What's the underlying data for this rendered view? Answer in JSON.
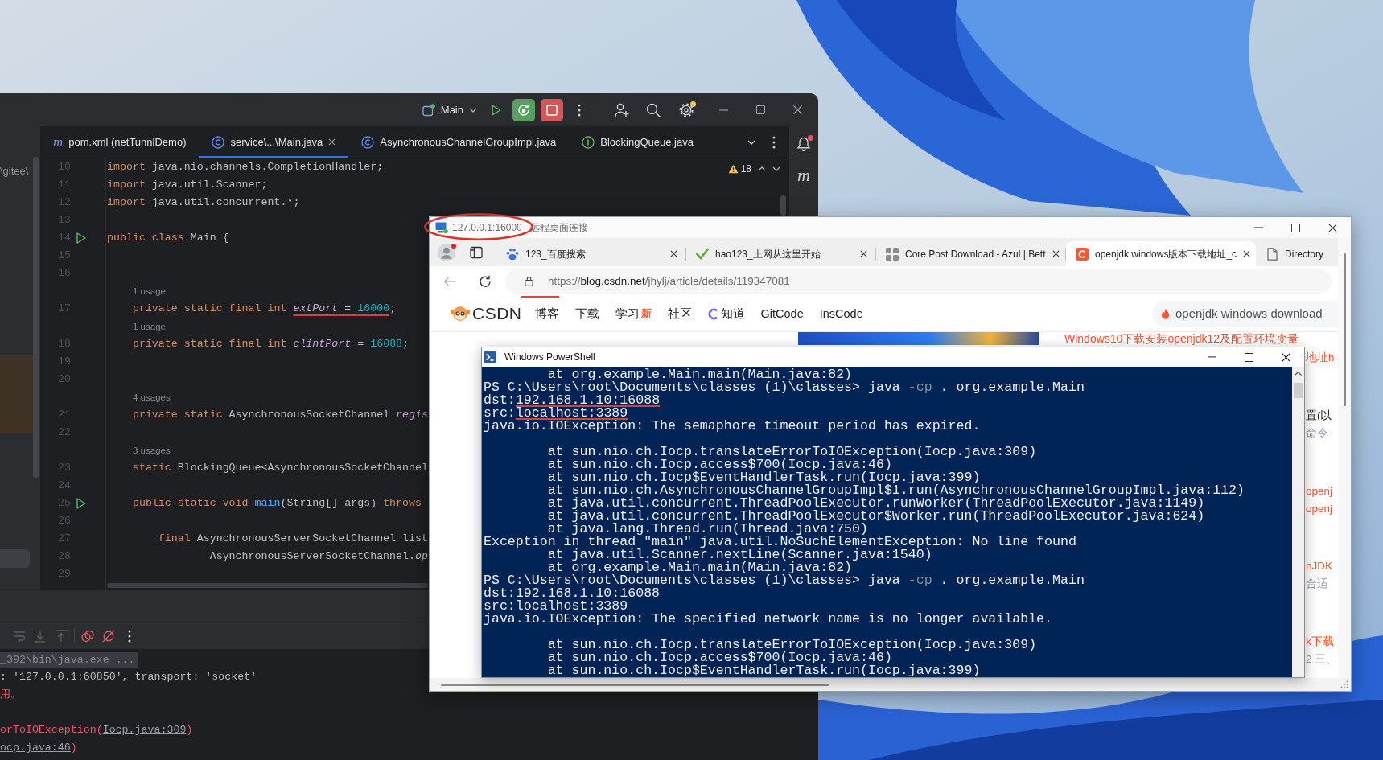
{
  "ide": {
    "run_config": "Main",
    "settings_badge": true,
    "notifications_unread": true,
    "tool_strip_glyph": "m",
    "project_path": "\\gitee\\",
    "problem_count": "18",
    "tabs": [
      {
        "kind": "maven",
        "glyph": "m",
        "label": "pom.xml (netTunnlDemo)",
        "selected": false
      },
      {
        "kind": "class",
        "label": "service\\...\\Main.java",
        "selected": true
      },
      {
        "kind": "class",
        "label": "AsynchronousChannelGroupImpl.java",
        "selected": false
      },
      {
        "kind": "interface",
        "label": "BlockingQueue.java",
        "selected": false
      }
    ],
    "rows": [
      {
        "kind": "code",
        "number": "10",
        "tokens": [
          {
            "text": "import",
            "kind": "keyword"
          },
          {
            "text": " java.nio.channels.CompletionHandler;",
            "kind": "plain"
          }
        ]
      },
      {
        "kind": "code",
        "number": "11",
        "tokens": [
          {
            "text": "import",
            "kind": "keyword"
          },
          {
            "text": " java.util.Scanner;",
            "kind": "plain"
          }
        ]
      },
      {
        "kind": "code",
        "number": "12",
        "tokens": [
          {
            "text": "import",
            "kind": "keyword"
          },
          {
            "text": " java.util.concurrent.*;",
            "kind": "plain"
          }
        ]
      },
      {
        "kind": "code",
        "number": "13"
      },
      {
        "kind": "code",
        "number": "14",
        "runnable": true,
        "tokens": [
          {
            "text": "public class",
            "kind": "keyword"
          },
          {
            "text": " Main {",
            "kind": "plain"
          }
        ]
      },
      {
        "kind": "code",
        "number": "15"
      },
      {
        "kind": "code",
        "number": "16"
      },
      {
        "kind": "hint",
        "text": "1 usage"
      },
      {
        "kind": "code",
        "number": "17",
        "tokens": [
          {
            "text": "    private static final int ",
            "kind": "keyword"
          },
          {
            "text": "extPort",
            "kind": "field",
            "marked": true
          },
          {
            "text": " = ",
            "kind": "plain",
            "marked": true
          },
          {
            "text": "16000",
            "kind": "number",
            "marked": true
          },
          {
            "text": ";",
            "kind": "plain"
          }
        ]
      },
      {
        "kind": "hint",
        "text": "1 usage"
      },
      {
        "kind": "code",
        "number": "18",
        "tokens": [
          {
            "text": "    private static final int ",
            "kind": "keyword"
          },
          {
            "text": "clintPort",
            "kind": "field"
          },
          {
            "text": " = ",
            "kind": "plain"
          },
          {
            "text": "16088",
            "kind": "number"
          },
          {
            "text": ";",
            "kind": "plain"
          }
        ]
      },
      {
        "kind": "code",
        "number": "19"
      },
      {
        "kind": "code",
        "number": "20"
      },
      {
        "kind": "hint",
        "text": "4 usages"
      },
      {
        "kind": "code",
        "number": "21",
        "tokens": [
          {
            "text": "    private static ",
            "kind": "keyword"
          },
          {
            "text": "AsynchronousSocketChannel ",
            "kind": "plain"
          },
          {
            "text": "regis",
            "kind": "field"
          }
        ]
      },
      {
        "kind": "code",
        "number": "22"
      },
      {
        "kind": "hint",
        "text": "3 usages"
      },
      {
        "kind": "code",
        "number": "23",
        "tokens": [
          {
            "text": "    static ",
            "kind": "keyword"
          },
          {
            "text": "BlockingQueue<AsynchronousSocketChannel",
            "kind": "plain"
          }
        ]
      },
      {
        "kind": "code",
        "number": "24"
      },
      {
        "kind": "code",
        "number": "25",
        "runnable": true,
        "tokens": [
          {
            "text": "    public static void ",
            "kind": "keyword"
          },
          {
            "text": "main",
            "kind": "method"
          },
          {
            "text": "(String[] args) ",
            "kind": "plain"
          },
          {
            "text": "throws",
            "kind": "keyword"
          }
        ]
      },
      {
        "kind": "code",
        "number": "26"
      },
      {
        "kind": "code",
        "number": "27",
        "tokens": [
          {
            "text": "        final ",
            "kind": "keyword"
          },
          {
            "text": "AsynchronousServerSocketChannel list",
            "kind": "plain"
          }
        ]
      },
      {
        "kind": "code",
        "number": "28",
        "tokens": [
          {
            "text": "                AsynchronousServerSocketChannel.",
            "kind": "plain"
          },
          {
            "text": "op",
            "kind": "static_call"
          }
        ]
      },
      {
        "kind": "code",
        "number": "29"
      }
    ],
    "console_toolbar": [
      {
        "kind": "soft_wrap",
        "disabled": true
      },
      {
        "kind": "scroll_down",
        "disabled": true
      },
      {
        "kind": "scroll_up",
        "disabled": true
      },
      {
        "kind": "breakpoints",
        "disabled": false
      },
      {
        "kind": "mute",
        "disabled": false
      },
      {
        "kind": "more",
        "disabled": false
      }
    ],
    "console": [
      {
        "kind": "folded",
        "text": "_392\\bin\\java.exe ..."
      },
      {
        "kind": "output",
        "parts": [
          {
            "text": ": '127.0.0.1:60850', transport: 'socket'",
            "kind": "plain"
          }
        ]
      },
      {
        "kind": "output",
        "parts": [
          {
            "text": "用。",
            "kind": "error"
          }
        ]
      },
      {
        "kind": "blank"
      },
      {
        "kind": "output",
        "parts": [
          {
            "text": "orToIOException(",
            "kind": "error"
          },
          {
            "text": "Iocp.java:309",
            "kind": "link"
          },
          {
            "text": ")",
            "kind": "error"
          }
        ]
      },
      {
        "kind": "output",
        "parts": [
          {
            "text": "ocp.java:46",
            "kind": "link"
          },
          {
            "text": ")",
            "kind": "error"
          }
        ]
      }
    ]
  },
  "rdp": {
    "title": "127.0.0.1:16000 - 远程桌面连接",
    "title_circled": true
  },
  "browser": {
    "profile_alert": true,
    "back_disabled": true,
    "tabs": [
      {
        "kind": "paw",
        "label": "123_百度搜索",
        "selected": false
      },
      {
        "kind": "check",
        "label": "hao123_上网从这里开始",
        "selected": false
      },
      {
        "kind": "grid",
        "label": "Core Post Download - Azul | Bett",
        "selected": false
      },
      {
        "kind": "tile",
        "label": "openjdk windows版本下载地址_c",
        "selected": true
      },
      {
        "kind": "page",
        "label": "Directory",
        "selected": false
      }
    ],
    "url": [
      {
        "text": "https://",
        "kind": "dim"
      },
      {
        "text": "blog.csdn.net",
        "kind": "host"
      },
      {
        "text": "/jhylj/article/details/119347081",
        "kind": "dim"
      }
    ],
    "site": {
      "brand": "CSDN",
      "nav": [
        {
          "label": "博客"
        },
        {
          "label": "下载"
        },
        {
          "label": "学习",
          "badge": "新"
        },
        {
          "label": "社区"
        },
        {
          "label": "知道",
          "logo": true
        },
        {
          "label": "GitCode"
        },
        {
          "label": "InsCode"
        }
      ],
      "search": {
        "placeholder": "openjdk windows download"
      },
      "headline": [
        {
          "text": "Windows10",
          "kind": "highlight"
        },
        {
          "text": "下载安装",
          "kind": "plain"
        },
        {
          "text": "openjdk",
          "kind": "highlight"
        },
        {
          "text": "12及配置环境变量",
          "kind": "plain"
        }
      ],
      "side_items": [
        {
          "lines": [
            {
              "text": "地址h",
              "kind": "link"
            }
          ]
        },
        {
          "lines": [
            {
              "text": "置(以",
              "kind": "title"
            },
            {
              "text": "命令",
              "kind": "snippet"
            }
          ]
        },
        {
          "lines": [
            {
              "text": "openj",
              "kind": "link"
            },
            {
              "text": "openj",
              "kind": "link"
            }
          ]
        },
        {
          "lines": [
            {
              "text": "nJDK",
              "kind": "link"
            },
            {
              "text": "合适",
              "kind": "snippet"
            }
          ]
        },
        {
          "lines": [
            {
              "text": "k下载",
              "kind": "link"
            },
            {
              "text": "2 三、",
              "kind": "snippet"
            }
          ]
        }
      ]
    }
  },
  "powershell": {
    "title": "Windows PowerShell",
    "lines": [
      {
        "kind": "text",
        "parts": [
          {
            "text": "        at org.example.Main.main(Main.java:82)"
          }
        ]
      },
      {
        "kind": "text",
        "parts": [
          {
            "text": "PS C:\\Users\\root\\Documents\\classes (1)\\classes> java "
          },
          {
            "text": "-cp",
            "kind": "flag"
          },
          {
            "text": " . org.example.Main"
          }
        ]
      },
      {
        "kind": "text",
        "parts": [
          {
            "text": "dst:"
          },
          {
            "text": "192.168.1.10:16088",
            "marked": true
          }
        ]
      },
      {
        "kind": "text",
        "parts": [
          {
            "text": "src:"
          },
          {
            "text": "localhost:3389",
            "marked": true
          }
        ]
      },
      {
        "kind": "text",
        "parts": [
          {
            "text": "java.io.IOException: The semaphore timeout period has expired."
          }
        ]
      },
      {
        "kind": "blank"
      },
      {
        "kind": "text",
        "parts": [
          {
            "text": "        at sun.nio.ch.Iocp.translateErrorToIOException(Iocp.java:309)"
          }
        ]
      },
      {
        "kind": "text",
        "parts": [
          {
            "text": "        at sun.nio.ch.Iocp.access$700(Iocp.java:46)"
          }
        ]
      },
      {
        "kind": "text",
        "parts": [
          {
            "text": "        at sun.nio.ch.Iocp$EventHandlerTask.run(Iocp.java:399)"
          }
        ]
      },
      {
        "kind": "text",
        "parts": [
          {
            "text": "        at sun.nio.ch.AsynchronousChannelGroupImpl$1.run(AsynchronousChannelGroupImpl.java:112)"
          }
        ]
      },
      {
        "kind": "text",
        "parts": [
          {
            "text": "        at java.util.concurrent.ThreadPoolExecutor.runWorker(ThreadPoolExecutor.java:1149)"
          }
        ]
      },
      {
        "kind": "text",
        "parts": [
          {
            "text": "        at java.util.concurrent.ThreadPoolExecutor$Worker.run(ThreadPoolExecutor.java:624)"
          }
        ]
      },
      {
        "kind": "text",
        "parts": [
          {
            "text": "        at java.lang.Thread.run(Thread.java:750)"
          }
        ]
      },
      {
        "kind": "text",
        "parts": [
          {
            "text": "Exception in thread \"main\" java.util.NoSuchElementException: No line found"
          }
        ]
      },
      {
        "kind": "text",
        "parts": [
          {
            "text": "        at java.util.Scanner.nextLine(Scanner.java:1540)"
          }
        ]
      },
      {
        "kind": "text",
        "parts": [
          {
            "text": "        at org.example.Main.main(Main.java:82)"
          }
        ]
      },
      {
        "kind": "text",
        "parts": [
          {
            "text": "PS C:\\Users\\root\\Documents\\classes (1)\\classes> java "
          },
          {
            "text": "-cp",
            "kind": "flag"
          },
          {
            "text": " . org.example.Main"
          }
        ]
      },
      {
        "kind": "text",
        "parts": [
          {
            "text": "dst:192.168.1.10:16088"
          }
        ]
      },
      {
        "kind": "text",
        "parts": [
          {
            "text": "src:localhost:3389"
          }
        ]
      },
      {
        "kind": "text",
        "parts": [
          {
            "text": "java.io.IOException: The specified network name is no longer available."
          }
        ]
      },
      {
        "kind": "blank"
      },
      {
        "kind": "text",
        "parts": [
          {
            "text": "        at sun.nio.ch.Iocp.translateErrorToIOException(Iocp.java:309)"
          }
        ]
      },
      {
        "kind": "text",
        "parts": [
          {
            "text": "        at sun.nio.ch.Iocp.access$700(Iocp.java:46)"
          }
        ]
      },
      {
        "kind": "text",
        "parts": [
          {
            "text": "        at sun.nio.ch.Iocp$EventHandlerTask.run(Iocp.java:399)"
          }
        ]
      }
    ]
  }
}
